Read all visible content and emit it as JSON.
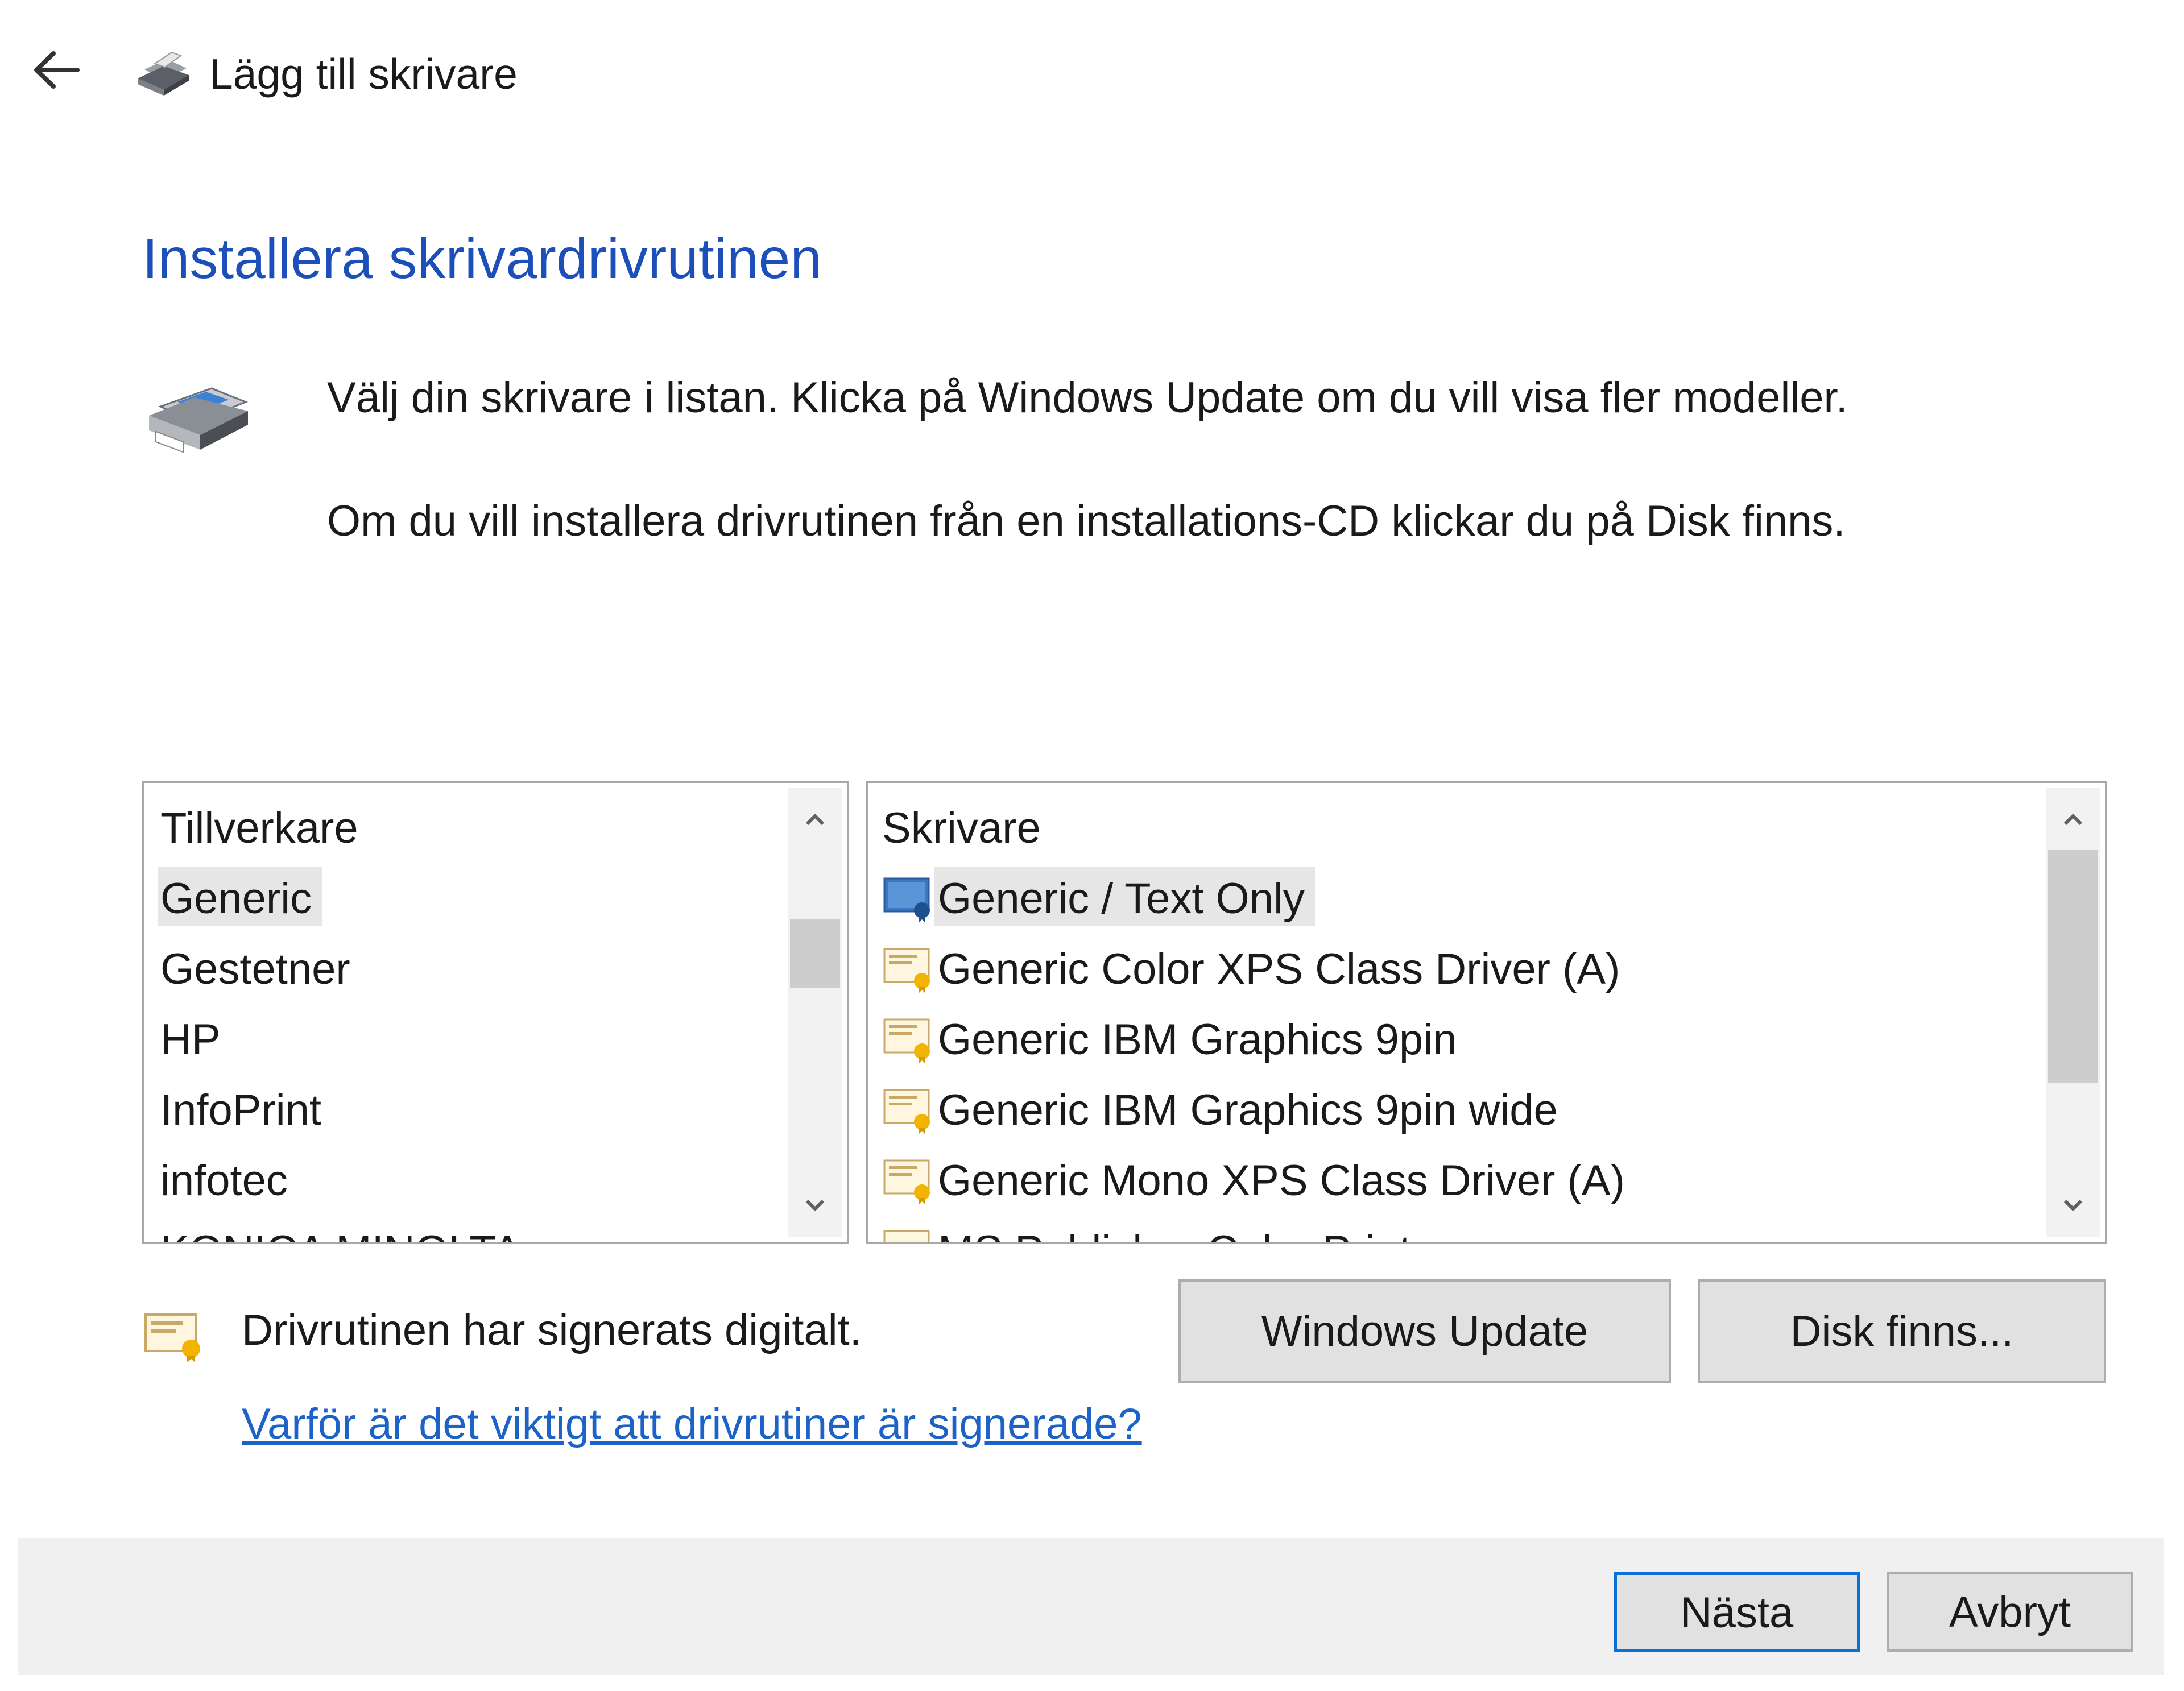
{
  "header": {
    "title": "Lägg till skrivare"
  },
  "main": {
    "heading": "Installera skrivardrivrutinen",
    "instruction_1": "Välj din skrivare i listan. Klicka på Windows Update om du vill visa fler modeller.",
    "instruction_2": "Om du vill installera drivrutinen från en installations-CD klickar du på Disk finns."
  },
  "manufacturers": {
    "header": "Tillverkare",
    "items": [
      {
        "label": "Generic",
        "selected": true
      },
      {
        "label": "Gestetner",
        "selected": false
      },
      {
        "label": "HP",
        "selected": false
      },
      {
        "label": "InfoPrint",
        "selected": false
      },
      {
        "label": "infotec",
        "selected": false
      },
      {
        "label": "KONICA MINOLTA",
        "selected": false
      }
    ]
  },
  "printers": {
    "header": "Skrivare",
    "items": [
      {
        "label": "Generic / Text Only",
        "selected": true,
        "icon": "generic-driver-icon"
      },
      {
        "label": "Generic Color XPS Class Driver (A)",
        "selected": false,
        "icon": "signed-driver-icon"
      },
      {
        "label": "Generic IBM Graphics 9pin",
        "selected": false,
        "icon": "signed-driver-icon"
      },
      {
        "label": "Generic IBM Graphics 9pin wide",
        "selected": false,
        "icon": "signed-driver-icon"
      },
      {
        "label": "Generic Mono XPS Class Driver (A)",
        "selected": false,
        "icon": "signed-driver-icon"
      },
      {
        "label": "MS Publisher Color Printer",
        "selected": false,
        "icon": "signed-driver-icon"
      }
    ]
  },
  "signature": {
    "text": "Drivrutinen har signerats digitalt.",
    "link": "Varför är det viktigt att drivrutiner är signerade?"
  },
  "buttons": {
    "windows_update": "Windows Update",
    "have_disk": "Disk finns...",
    "next": "Nästa",
    "cancel": "Avbryt"
  },
  "colors": {
    "heading": "#1d4fbb",
    "link": "#1d63c7",
    "default_button_border": "#0a70d8",
    "footer_bg": "#f0f0f0"
  }
}
